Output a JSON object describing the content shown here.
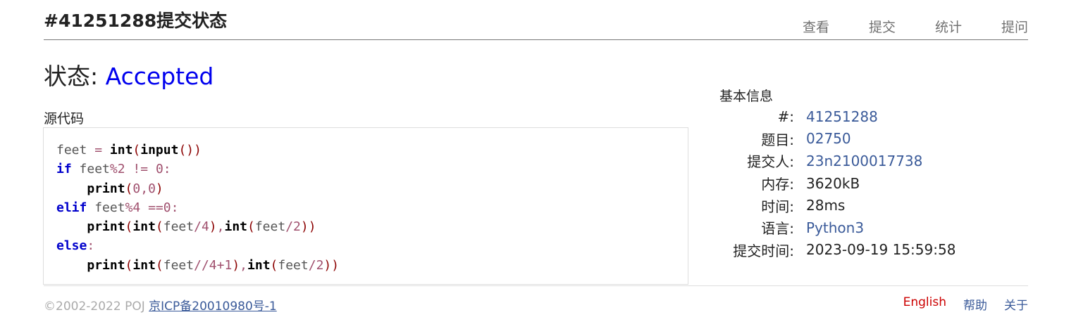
{
  "header": {
    "title": "#41251288提交状态",
    "nav": [
      "查看",
      "提交",
      "统计",
      "提问"
    ]
  },
  "status": {
    "label": "状态:",
    "value": "Accepted"
  },
  "source": {
    "label": "源代码",
    "code_lines": [
      "feet = int(input())",
      "if feet%2 != 0:",
      "    print(0,0)",
      "elif feet%4 ==0:",
      "    print(int(feet/4),int(feet/2))",
      "else:",
      "    print(int(feet//4+1),int(feet/2))"
    ]
  },
  "info": {
    "title": "基本信息",
    "rows": [
      {
        "key": "#:",
        "value": "41251288"
      },
      {
        "key": "题目:",
        "value": "02750"
      },
      {
        "key": "提交人:",
        "value": "23n2100017738"
      },
      {
        "key": "内存:",
        "value": "3620kB"
      },
      {
        "key": "时间:",
        "value": "28ms"
      },
      {
        "key": "语言:",
        "value": "Python3"
      },
      {
        "key": "提交时间:",
        "value": "2023-09-19 15:59:58"
      }
    ]
  },
  "footer": {
    "copyright": "©2002-2022 POJ",
    "icp": "京ICP备20010980号-1",
    "links": [
      "English",
      "帮助",
      "关于"
    ]
  },
  "colors": {
    "accepted": "#0000ee",
    "link": "#3a5a99",
    "english_link": "#cc0000"
  }
}
